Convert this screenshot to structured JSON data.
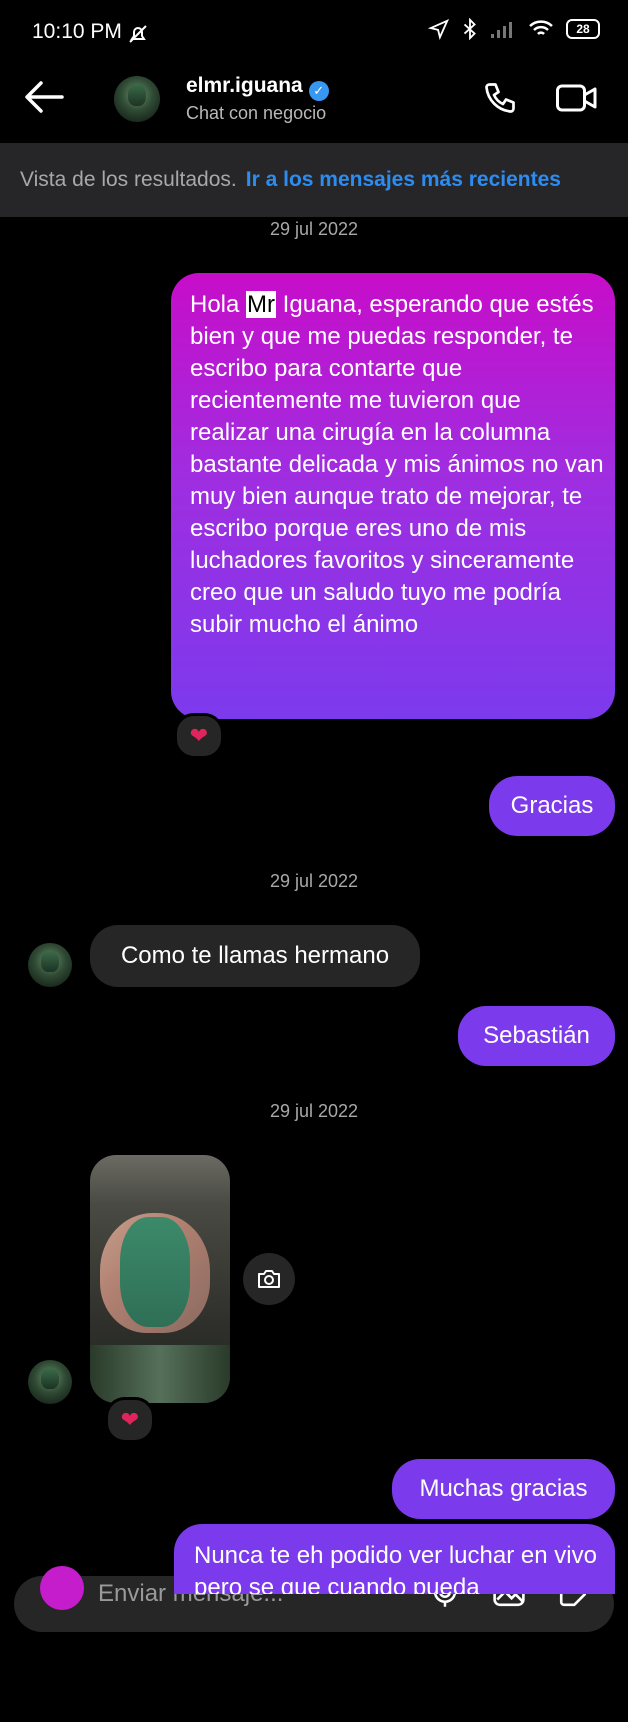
{
  "status_bar": {
    "time": "10:10 PM",
    "battery": "28"
  },
  "header": {
    "username": "elmr.iguana",
    "subtitle": "Chat con negocio"
  },
  "banner": {
    "text": "Vista de los resultados.",
    "link": "Ir a los mensajes más recientes"
  },
  "messages": {
    "date1": "29 jul 2022",
    "m1_pre": "Hola ",
    "m1_highlight": "Mr",
    "m1_post": " Iguana, esperando que estés bien y que me puedas responder, te escribo para contarte que recientemente me tuvieron que realizar una cirugía en la columna bastante delicada y mis ánimos no van muy bien aunque trato de mejorar, te escribo porque eres uno de mis luchadores favoritos y sinceramente creo que un saludo tuyo me podría subir mucho el ánimo",
    "m2": "Gracias",
    "date2": "29 jul 2022",
    "m3": "Como te llamas hermano",
    "m4": "Sebastián",
    "date3": "29 jul 2022",
    "m5": "Muchas gracias",
    "m6": "Nunca te eh podido ver luchar en vivo pero se que cuando pueda"
  },
  "composer": {
    "placeholder": "Enviar mensaje..."
  },
  "colors": {
    "sent": "#7c3aed",
    "accent_link": "#2d8cf0",
    "received": "#262626"
  }
}
